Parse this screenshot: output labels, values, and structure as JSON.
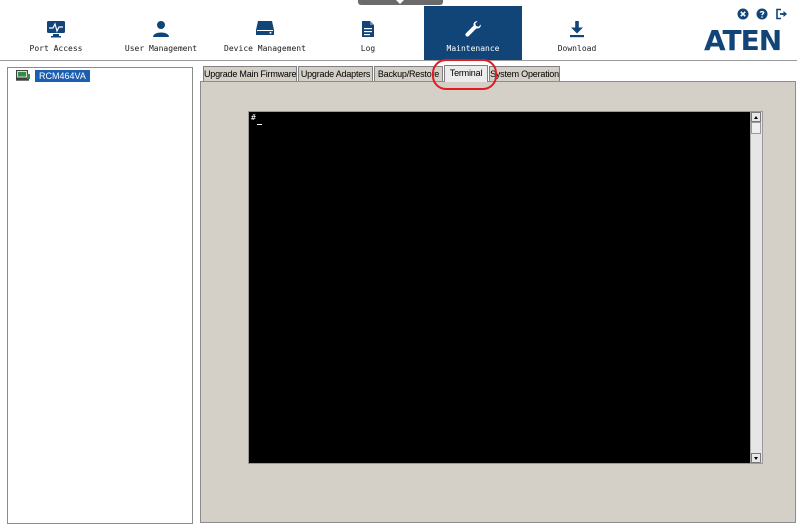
{
  "nav": {
    "items": [
      {
        "label": "Port Access",
        "icon": "monitor-pulse-icon"
      },
      {
        "label": "User Management",
        "icon": "user-icon"
      },
      {
        "label": "Device Management",
        "icon": "server-icon"
      },
      {
        "label": "Log",
        "icon": "document-icon"
      },
      {
        "label": "Maintenance",
        "icon": "wrench-icon"
      },
      {
        "label": "Download",
        "icon": "download-icon"
      }
    ],
    "active": "Maintenance"
  },
  "brand": {
    "logo": "ATEN",
    "color": "#114577"
  },
  "tree": {
    "selected_device": "RCM464VA"
  },
  "tabs": [
    {
      "label": "Upgrade Main Firmware"
    },
    {
      "label": "Upgrade Adapters"
    },
    {
      "label": "Backup/Restore"
    },
    {
      "label": "Terminal"
    },
    {
      "label": "System Operation"
    }
  ],
  "selected_tab": "Terminal",
  "terminal": {
    "prompt": "#"
  },
  "colors": {
    "accent": "#114577",
    "highlight": "#e11b22",
    "selection": "#1c5fb0"
  }
}
